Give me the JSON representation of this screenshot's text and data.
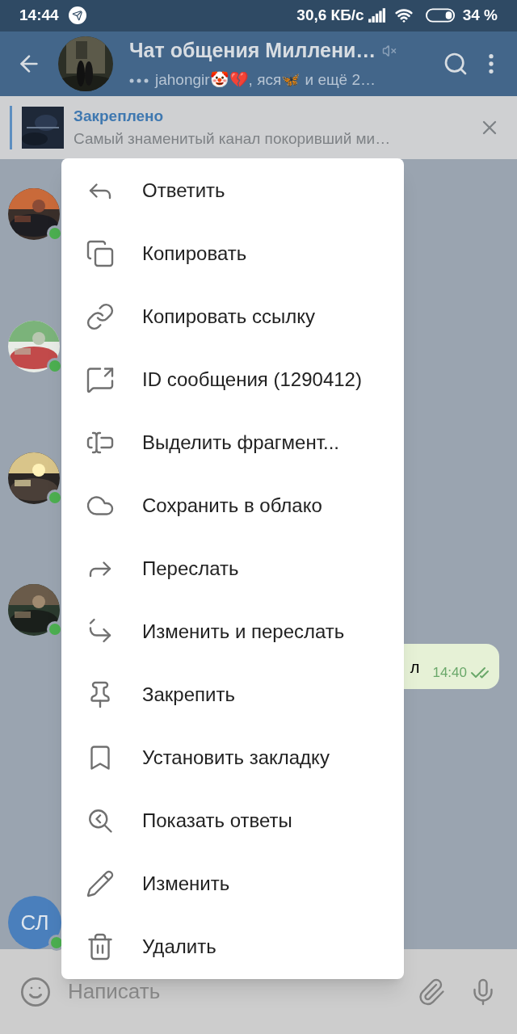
{
  "status_bar": {
    "time": "14:44",
    "speed": "30,6 КБ/с",
    "battery": "34 %"
  },
  "header": {
    "title": "Чат общения Миллени…",
    "subtitle": "jahongir🤡💔, яся🦋 и ещё 2…",
    "muted": true
  },
  "pinned": {
    "label": "Закреплено",
    "text": "Самый знаменитый канал покоривший ми…"
  },
  "chat": {
    "avatars": [
      {
        "kind": "picture",
        "online": true
      },
      {
        "kind": "picture",
        "online": true
      },
      {
        "kind": "picture",
        "online": true
      },
      {
        "kind": "picture",
        "online": true
      }
    ],
    "message": {
      "text": "л",
      "time": "14:40"
    },
    "last_avatar": {
      "initials": "СЛ",
      "online": true
    }
  },
  "menu": [
    "Ответить",
    "Копировать",
    "Копировать ссылку",
    "ID сообщения (1290412)",
    "Выделить фрагмент...",
    "Сохранить в облако",
    "Переслать",
    "Изменить и переслать",
    "Закрепить",
    "Установить закладку",
    "Показать ответы",
    "Изменить",
    "Удалить"
  ],
  "input": {
    "placeholder": "Написать"
  }
}
